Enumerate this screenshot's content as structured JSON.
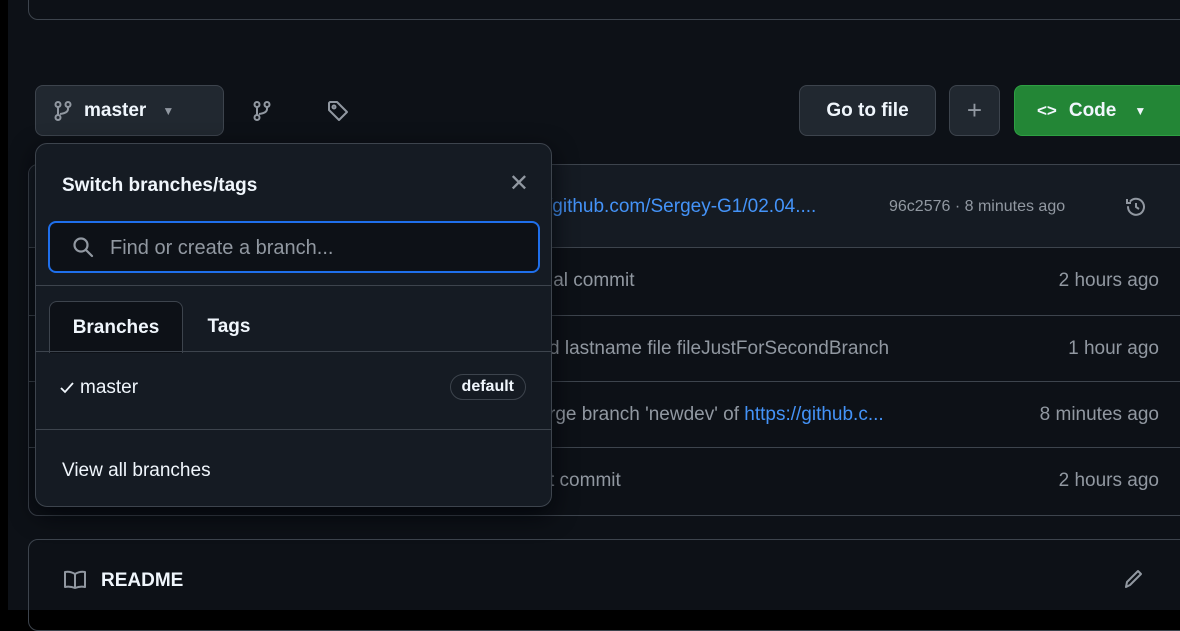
{
  "branch_bar": {
    "current_branch": "master",
    "go_to_file": "Go to file",
    "add_icon": "plus-icon",
    "code_label": "Code",
    "accent": "#238636"
  },
  "latest_commit": {
    "message_link": "/github.com/Sergey-G1/02.04....",
    "hash_time": "96c2576 · 8 minutes ago"
  },
  "commits": [
    {
      "message": "ial commit",
      "link": "",
      "time": "2 hours ago"
    },
    {
      "message": "d lastname file fileJustForSecondBranch",
      "link": "",
      "time": "1 hour ago"
    },
    {
      "message": "rge branch 'newdev' of ",
      "link": "https://github.c...",
      "time": "8 minutes ago"
    },
    {
      "message": "t commit",
      "link": "",
      "time": "2 hours ago"
    }
  ],
  "readme": {
    "title": "README"
  },
  "dropdown": {
    "title": "Switch branches/tags",
    "search_placeholder": "Find or create a branch...",
    "tabs": [
      "Branches",
      "Tags"
    ],
    "branches": [
      {
        "name": "master",
        "badge": "default",
        "selected": true
      }
    ],
    "view_all": "View all branches"
  }
}
